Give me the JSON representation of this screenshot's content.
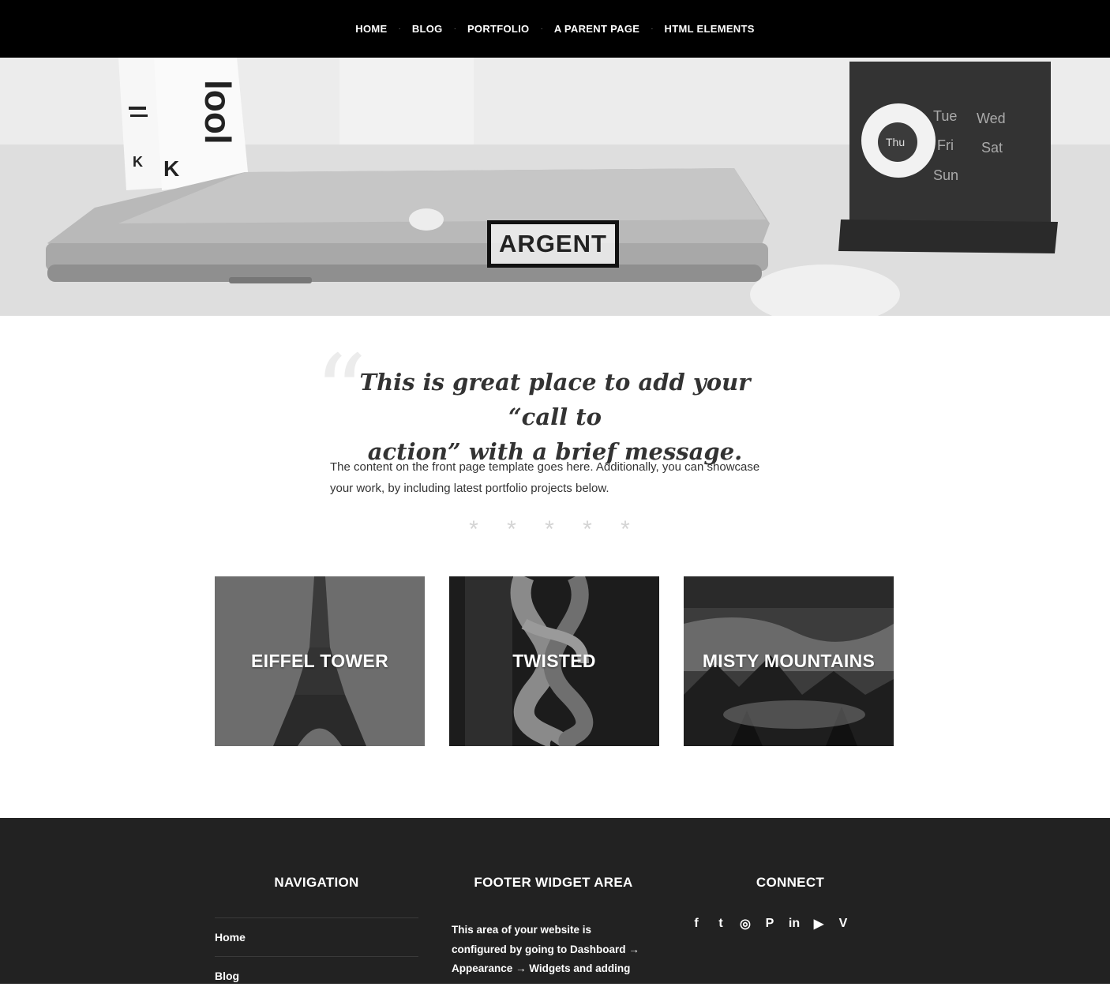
{
  "nav": {
    "items": [
      "HOME",
      "BLOG",
      "PORTFOLIO",
      "A PARENT PAGE",
      "HTML ELEMENTS"
    ],
    "separator": "·"
  },
  "hero": {
    "logo": "ARGENT",
    "calendar_days": [
      "Tue",
      "Wed",
      "Thu",
      "Fri",
      "Sat",
      "Sun"
    ],
    "book_letter": "K",
    "book_spine_text": "lool"
  },
  "intro": {
    "quote_mark": "“",
    "cta_line1": "This is great place to add your “call to",
    "cta_line2": "action” with a brief message.",
    "paragraph": "The content on the front page template goes here. Additionally, you can showcase your work, by including latest portfolio projects below.",
    "stars": "* * * * *"
  },
  "portfolio": [
    {
      "title": "EIFFEL TOWER"
    },
    {
      "title": "TWISTED"
    },
    {
      "title": "MISTY MOUNTAINS"
    }
  ],
  "footer": {
    "navigation": {
      "heading": "NAVIGATION",
      "links": [
        "Home",
        "Blog"
      ]
    },
    "widget": {
      "heading": "FOOTER WIDGET AREA",
      "text": "This area of your website is configured by going to Dashboard → Appearance → Widgets and adding widgets to the Footer widgets area."
    },
    "connect": {
      "heading": "CONNECT",
      "icons": [
        {
          "name": "facebook-icon",
          "glyph": "f"
        },
        {
          "name": "twitter-icon",
          "glyph": "t"
        },
        {
          "name": "instagram-icon",
          "glyph": "◎"
        },
        {
          "name": "pinterest-icon",
          "glyph": "P"
        },
        {
          "name": "linkedin-icon",
          "glyph": "in"
        },
        {
          "name": "youtube-icon",
          "glyph": "▶"
        },
        {
          "name": "vimeo-icon",
          "glyph": "V"
        }
      ]
    }
  },
  "colors": {
    "nav_bg": "#000000",
    "footer_bg": "#222222",
    "text": "#333333",
    "stars": "#d4d4d4"
  }
}
